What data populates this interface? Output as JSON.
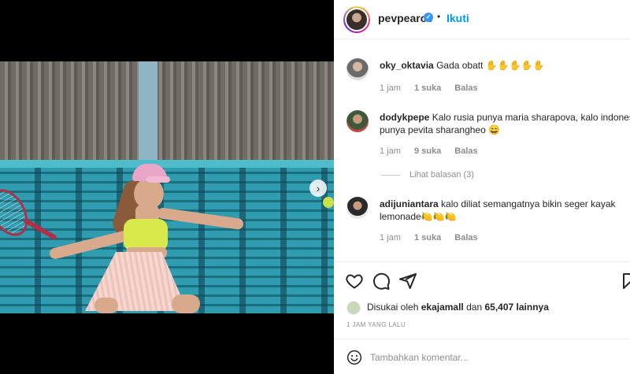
{
  "post": {
    "photo_alt": "Tennis player photo",
    "next_label": "›"
  },
  "header": {
    "username": "pevpearce",
    "verified_mark": "✓",
    "separator": "•",
    "follow_label": "Ikuti"
  },
  "comments": [
    {
      "username": "oky_oktavia",
      "text": "Gada obatt ✋✋✋✋✋",
      "time": "1 jam",
      "likes": "1 suka",
      "reply_label": "Balas"
    },
    {
      "username": "dodykpepe",
      "text_line1": "Kalo rusia punya maria sharapova, kalo indones",
      "text_line2": "punya pevita sharangheo 😄",
      "time": "1 jam",
      "likes": "9 suka",
      "reply_label": "Balas"
    },
    {
      "username": "adijuniantara",
      "text_line1": "kalo diliat semangatnya bikin seger kayak",
      "text_line2": "lemonade🍋🍋🍋",
      "time": "1 jam",
      "likes": "1 suka",
      "reply_label": "Balas"
    }
  ],
  "view_replies": "Lihat balasan (3)",
  "actions": {
    "like_icon": "heart-icon",
    "comment_icon": "comment-icon",
    "share_icon": "share-icon",
    "save_icon": "bookmark-icon"
  },
  "likes_summary": {
    "prefix": "Disukai oleh",
    "first_liker": "ekajamall",
    "conjunction": "dan",
    "others_count": "65,407 lainnya"
  },
  "timestamp": "1 JAM YANG LALU",
  "add_comment": {
    "placeholder": "Tambahkan komentar..."
  },
  "colors": {
    "accent": "#0095f6",
    "text": "#262626",
    "muted": "#8e8e8e"
  }
}
